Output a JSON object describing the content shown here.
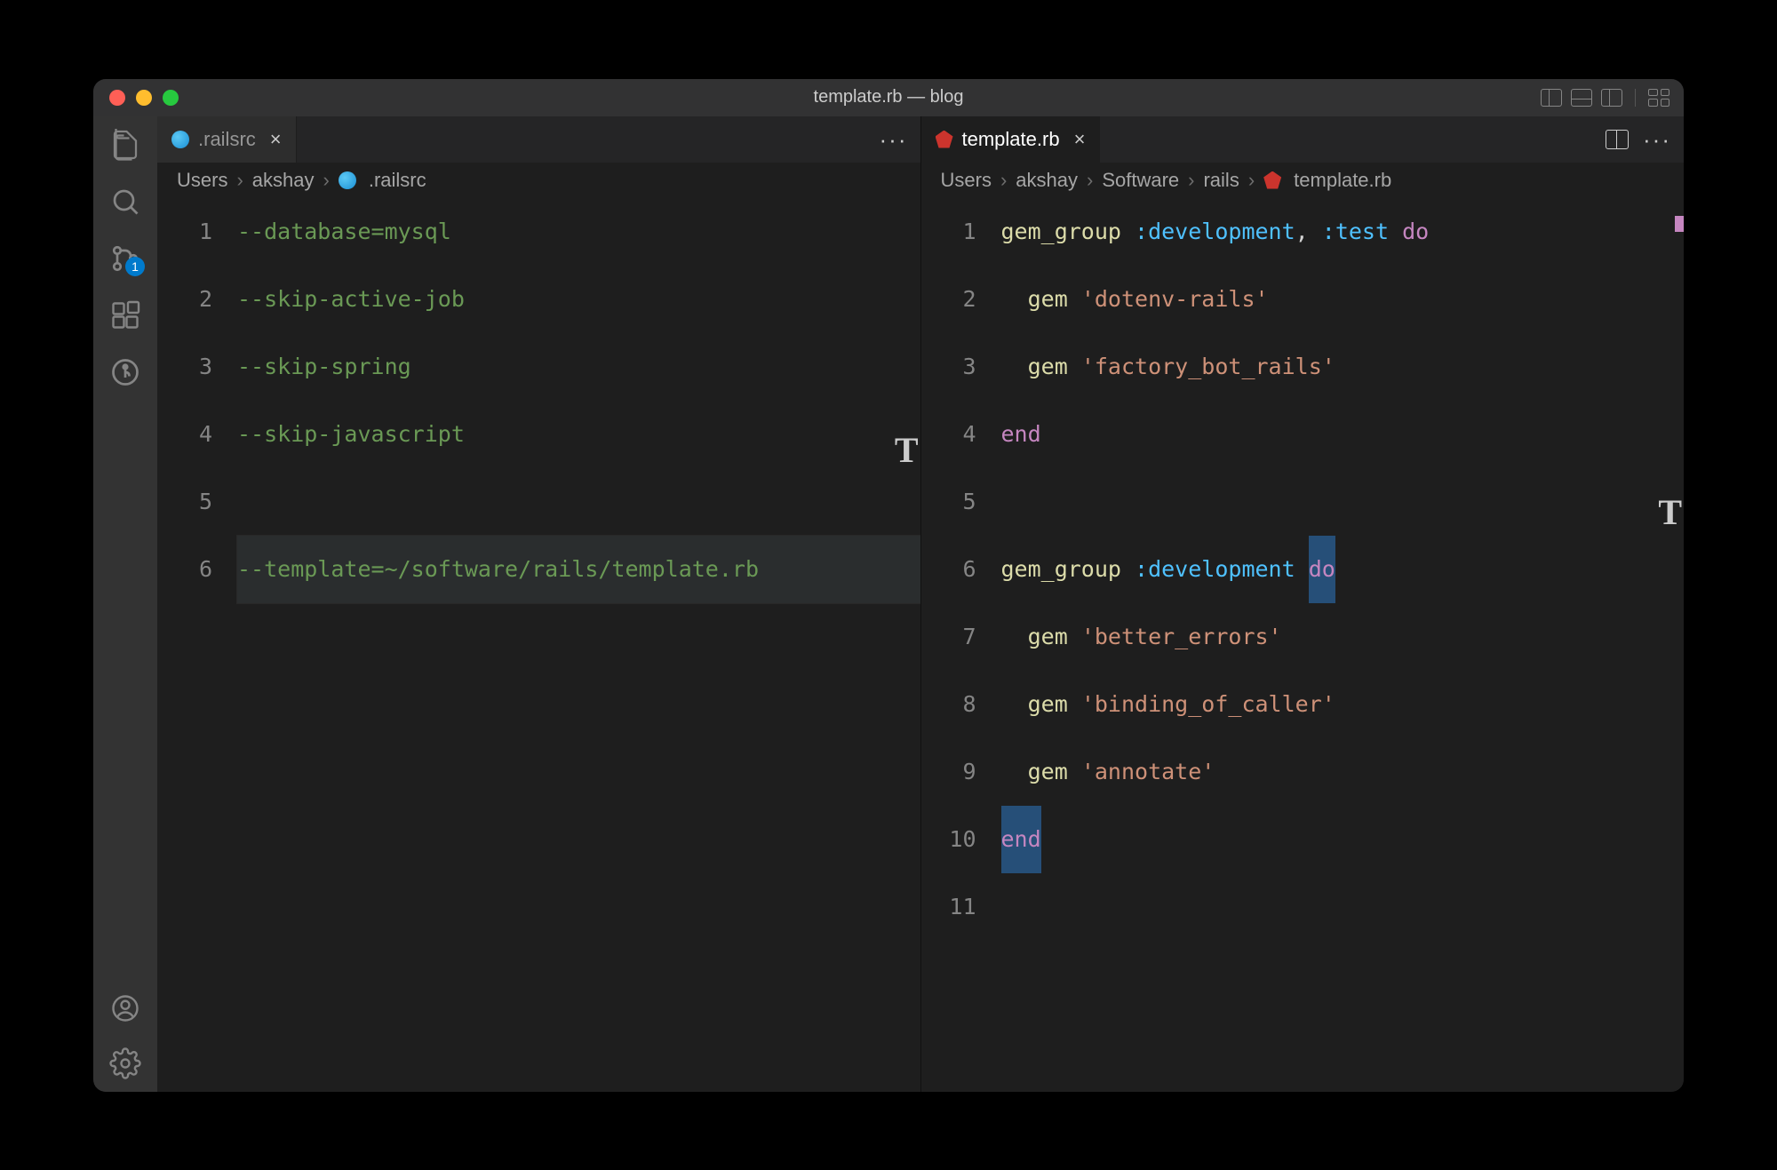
{
  "window": {
    "title": "template.rb — blog"
  },
  "activitybar": {
    "scm_badge": "1"
  },
  "editor_left": {
    "tab": {
      "filename": ".railsrc"
    },
    "breadcrumbs": [
      "Users",
      "akshay",
      ".railsrc"
    ],
    "lines": [
      {
        "num": "1",
        "tokens": [
          {
            "cls": "tk-green",
            "t": "--database=mysql"
          }
        ]
      },
      {
        "num": "2",
        "tokens": [
          {
            "cls": "tk-green",
            "t": "--skip-active-job"
          }
        ]
      },
      {
        "num": "3",
        "tokens": [
          {
            "cls": "tk-green",
            "t": "--skip-spring"
          }
        ]
      },
      {
        "num": "4",
        "tokens": [
          {
            "cls": "tk-green",
            "t": "--skip-javascript"
          }
        ]
      },
      {
        "num": "5",
        "tokens": []
      },
      {
        "num": "6",
        "current": true,
        "tokens": [
          {
            "cls": "tk-green",
            "t": "--template=~/software/rails/template.rb"
          }
        ]
      }
    ]
  },
  "editor_right": {
    "tab": {
      "filename": "template.rb"
    },
    "breadcrumbs": [
      "Users",
      "akshay",
      "Software",
      "rails",
      "template.rb"
    ],
    "lines": [
      {
        "num": "1",
        "tokens": [
          {
            "cls": "tk-func",
            "t": "gem_group"
          },
          {
            "cls": "",
            "t": " "
          },
          {
            "cls": "tk-sym",
            "t": ":development"
          },
          {
            "cls": "tk-punc",
            "t": ", "
          },
          {
            "cls": "tk-sym",
            "t": ":test"
          },
          {
            "cls": "",
            "t": " "
          },
          {
            "cls": "tk-key",
            "t": "do"
          }
        ]
      },
      {
        "num": "2",
        "tokens": [
          {
            "cls": "",
            "t": "  "
          },
          {
            "cls": "tk-func",
            "t": "gem"
          },
          {
            "cls": "",
            "t": " "
          },
          {
            "cls": "tk-str",
            "t": "'dotenv-rails'"
          }
        ]
      },
      {
        "num": "3",
        "tokens": [
          {
            "cls": "",
            "t": "  "
          },
          {
            "cls": "tk-func",
            "t": "gem"
          },
          {
            "cls": "",
            "t": " "
          },
          {
            "cls": "tk-str",
            "t": "'factory_bot_rails'"
          }
        ]
      },
      {
        "num": "4",
        "tokens": [
          {
            "cls": "tk-end",
            "t": "end"
          }
        ]
      },
      {
        "num": "5",
        "tokens": []
      },
      {
        "num": "6",
        "tokens": [
          {
            "cls": "tk-func",
            "t": "gem_group"
          },
          {
            "cls": "",
            "t": " "
          },
          {
            "cls": "tk-sym",
            "t": ":development"
          },
          {
            "cls": "",
            "t": " "
          },
          {
            "cls": "tk-key",
            "t": "do",
            "hl": true
          }
        ]
      },
      {
        "num": "7",
        "tokens": [
          {
            "cls": "",
            "t": "  "
          },
          {
            "cls": "tk-func",
            "t": "gem"
          },
          {
            "cls": "",
            "t": " "
          },
          {
            "cls": "tk-str",
            "t": "'better_errors'"
          }
        ]
      },
      {
        "num": "8",
        "tokens": [
          {
            "cls": "",
            "t": "  "
          },
          {
            "cls": "tk-func",
            "t": "gem"
          },
          {
            "cls": "",
            "t": " "
          },
          {
            "cls": "tk-str",
            "t": "'binding_of_caller'"
          }
        ]
      },
      {
        "num": "9",
        "tokens": [
          {
            "cls": "",
            "t": "  "
          },
          {
            "cls": "tk-func",
            "t": "gem"
          },
          {
            "cls": "",
            "t": " "
          },
          {
            "cls": "tk-str",
            "t": "'annotate'"
          }
        ]
      },
      {
        "num": "10",
        "tokens": [
          {
            "cls": "tk-end",
            "t": "end",
            "hl": true
          }
        ]
      },
      {
        "num": "11",
        "tokens": []
      }
    ]
  }
}
